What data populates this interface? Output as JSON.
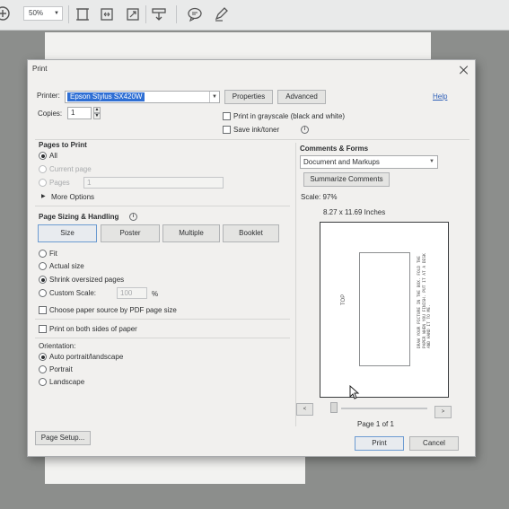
{
  "toolbar": {
    "zoom_value": "50%",
    "icons": [
      "add-icon",
      "fit-page-icon",
      "fit-width-icon",
      "full-screen-icon",
      "download-icon",
      "comment-icon",
      "pen-icon"
    ]
  },
  "dialog": {
    "title": "Print",
    "printer": {
      "label": "Printer:",
      "value": "Epson Stylus SX420W",
      "properties_button": "Properties",
      "advanced_button": "Advanced",
      "help_link": "Help"
    },
    "copies": {
      "label": "Copies:",
      "value": "1"
    },
    "options": {
      "grayscale": "Print in grayscale (black and white)",
      "save_ink": "Save ink/toner"
    },
    "pages_to_print": {
      "header": "Pages to Print",
      "all": "All",
      "current_page": "Current page",
      "pages": "Pages",
      "pages_value": "1",
      "more_options": "More Options"
    },
    "page_sizing": {
      "header": "Page Sizing & Handling",
      "tabs": [
        "Size",
        "Poster",
        "Multiple",
        "Booklet"
      ],
      "fit": "Fit",
      "actual_size": "Actual size",
      "shrink": "Shrink oversized pages",
      "custom_scale": "Custom Scale:",
      "custom_scale_value": "100",
      "custom_scale_unit": "%",
      "paper_source": "Choose paper source by PDF page size",
      "both_sides": "Print on both sides of paper"
    },
    "orientation": {
      "header": "Orientation:",
      "auto": "Auto portrait/landscape",
      "portrait": "Portrait",
      "landscape": "Landscape"
    },
    "comments_forms": {
      "header": "Comments & Forms",
      "value": "Document and Markups",
      "summarize_button": "Summarize Comments"
    },
    "preview": {
      "scale": "Scale: 97%",
      "paper_size": "8.27 x 11.69 Inches",
      "top_label": "TOP",
      "note": "DRAW YOUR PICTURE IN THE BOX. FOLD THE PAPER WHEN YOU FINISH. PUT IT AT A DESK AND HAND IT TO ME.",
      "page_of": "Page 1 of 1",
      "prev": "<",
      "next": ">"
    },
    "footer": {
      "page_setup": "Page Setup...",
      "print": "Print",
      "cancel": "Cancel"
    }
  }
}
